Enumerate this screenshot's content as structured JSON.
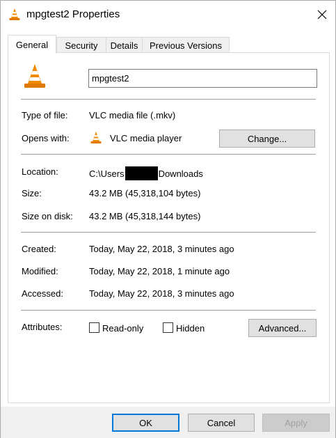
{
  "window": {
    "title": "mpgtest2 Properties",
    "icon": "vlc-cone-icon",
    "close_icon": "close-icon"
  },
  "tabs": [
    {
      "label": "General",
      "active": true
    },
    {
      "label": "Security",
      "active": false
    },
    {
      "label": "Details",
      "active": false
    },
    {
      "label": "Previous Versions",
      "active": false
    }
  ],
  "general": {
    "file_name": "mpgtest2",
    "type_label": "Type of file:",
    "type_value": "VLC media file (.mkv)",
    "opens_label": "Opens with:",
    "opens_value": "VLC media player",
    "change_button": "Change...",
    "location_label": "Location:",
    "location_prefix": "C:\\Users",
    "location_suffix": "Downloads",
    "size_label": "Size:",
    "size_value": "43.2 MB (45,318,104 bytes)",
    "size_on_disk_label": "Size on disk:",
    "size_on_disk_value": "43.2 MB (45,318,144 bytes)",
    "created_label": "Created:",
    "created_value": "Today, May 22, 2018, 3 minutes ago",
    "modified_label": "Modified:",
    "modified_value": "Today, May 22, 2018, 1 minute ago",
    "accessed_label": "Accessed:",
    "accessed_value": "Today, May 22, 2018, 3 minutes ago",
    "attributes_label": "Attributes:",
    "readonly_label": "Read-only",
    "readonly_checked": false,
    "hidden_label": "Hidden",
    "hidden_checked": false,
    "advanced_button": "Advanced..."
  },
  "footer": {
    "ok": "OK",
    "cancel": "Cancel",
    "apply": "Apply"
  },
  "colors": {
    "vlc_orange": "#f08a00",
    "accent": "#0078d7"
  }
}
